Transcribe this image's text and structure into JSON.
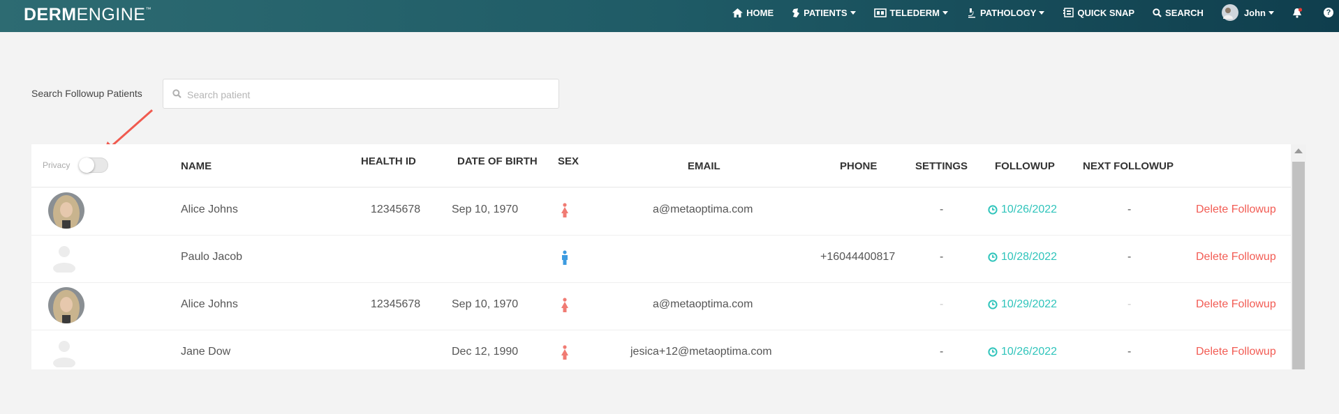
{
  "header": {
    "logo_bold": "DERM",
    "logo_light": "ENGINE",
    "logo_tm": "™",
    "nav": {
      "home": "HOME",
      "patients": "PATIENTS",
      "telederm": "TELEDERM",
      "pathology": "PATHOLOGY",
      "quick_snap": "QUICK SNAP",
      "search": "SEARCH",
      "user": "John"
    },
    "help": "?"
  },
  "search": {
    "label": "Search Followup Patients",
    "placeholder": "Search patient",
    "value": ""
  },
  "table": {
    "privacy_label": "Privacy",
    "privacy_on": false,
    "columns": {
      "name": "NAME",
      "health_id": "HEALTH ID",
      "dob": "DATE OF BIRTH",
      "sex": "SEX",
      "email": "EMAIL",
      "phone": "PHONE",
      "settings": "SETTINGS",
      "followup": "FOLLOWUP",
      "next_followup": "NEXT FOLLOWUP"
    },
    "rows": [
      {
        "avatar": "photo",
        "name": "Alice Johns",
        "health_id": "12345678",
        "dob": "Sep 10, 1970",
        "sex": "female",
        "email": "a@metaoptima.com",
        "phone": "",
        "settings": "-",
        "followup": "10/26/2022",
        "next_followup": "-",
        "action": "Delete Followup"
      },
      {
        "avatar": "placeholder",
        "name": "Paulo Jacob",
        "health_id": "",
        "dob": "",
        "sex": "male",
        "email": "",
        "phone": "+16044400817",
        "settings": "-",
        "followup": "10/28/2022",
        "next_followup": "-",
        "action": "Delete Followup"
      },
      {
        "avatar": "photo",
        "name": "Alice Johns",
        "health_id": "12345678",
        "dob": "Sep 10, 1970",
        "sex": "female",
        "email": "a@metaoptima.com",
        "phone": "",
        "settings": "-",
        "followup": "10/29/2022",
        "next_followup": "-",
        "action": "Delete Followup"
      },
      {
        "avatar": "placeholder",
        "name": "Jane Dow",
        "health_id": "",
        "dob": "Dec 12, 1990",
        "sex": "female",
        "email": "jesica+12@metaoptima.com",
        "phone": "",
        "settings": "-",
        "followup": "10/26/2022",
        "next_followup": "-",
        "action": "Delete Followup"
      }
    ]
  },
  "colors": {
    "header_gradient_start": "#2d6b72",
    "header_gradient_end": "#0f3e4d",
    "followup": "#2fc4bb",
    "delete": "#f25c54",
    "female": "#f07b73",
    "male": "#3d9be0",
    "annotation_arrow": "#f05a4f"
  }
}
